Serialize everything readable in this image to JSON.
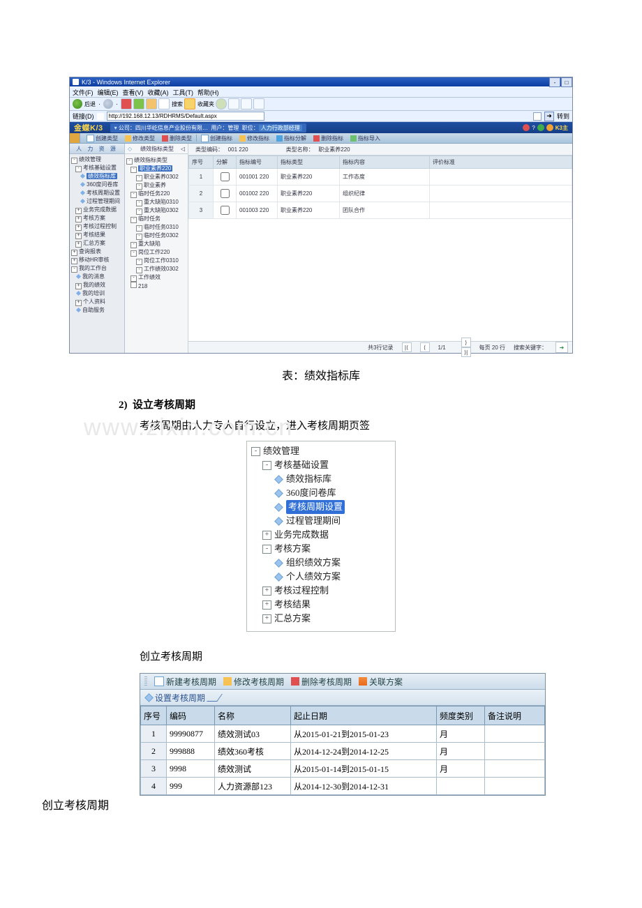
{
  "ie": {
    "title": "K/3 - Windows Internet Explorer",
    "menus": [
      "文件(F)",
      "编辑(E)",
      "查看(V)",
      "收藏(A)",
      "工具(T)",
      "帮助(H)"
    ],
    "toolbar": {
      "back": "后退",
      "search": "搜索",
      "fav": "收藏夹"
    },
    "address_label": "链接(D)",
    "address": "http://192.168.12.13/RDHRMS/Default.aspx",
    "go": "转到"
  },
  "k3": {
    "logo": "金蝶K/3",
    "company": "公司：四川华屹信息产业股份有限…",
    "user": "用户：管理",
    "post_label": "职位：",
    "post": "人力行政部经理",
    "right": "K3主",
    "toolbar": {
      "newtype": "创建类型",
      "edittype": "修改类型",
      "deltype": "删除类型",
      "newind": "创建指标",
      "editind": "修改指标",
      "cat": "指标分解",
      "delind": "删除指标",
      "import": "指标导入"
    },
    "navtitle": "人 力 资 源",
    "nav": {
      "root": "绩效管理",
      "base": "考核基础设置",
      "lib": "绩效指标库",
      "q360": "360度问卷库",
      "cycle": "考核周期设置",
      "period": "过程管理期间",
      "biz": "业务完成数据",
      "plan": "考核方案",
      "proc": "考核过程控制",
      "result": "考核结果",
      "sum": "汇总方案",
      "query": "查询报表",
      "mobile": "移动HR审核",
      "mywork": "我的工作台",
      "mymsg": "我的消息",
      "myperf": "我的绩效",
      "mytrain": "我的培训",
      "myinfo": "个人资料",
      "selfserv": "自助服务"
    },
    "midhead": "绩效指标类型",
    "midhead_icon": "◁",
    "mid": [
      "绩效指标类型",
      "职业素养220",
      "职业素养0302",
      "职业素养",
      "临时任务220",
      "重大缺陷0310",
      "重大缺陷0302",
      "临时任务",
      "临时任务0310",
      "临时任务0302",
      "重大缺陷",
      "岗位工作220",
      "岗位工作0310",
      "工作绩效0302",
      "工作绩效",
      "218"
    ],
    "midsel": "职业素养220",
    "info": {
      "codelabel": "类型编码：",
      "code": "001 220",
      "namelabel": "类型名称：",
      "name": "职业素养220"
    },
    "cols": [
      "序号",
      "分解",
      "指标编号",
      "指标类型",
      "指标内容",
      "评价标准"
    ],
    "rows": [
      {
        "no": "1",
        "code": "001001 220",
        "type": "职业素养220",
        "content": "工作态度"
      },
      {
        "no": "2",
        "code": "001002 220",
        "type": "职业素养220",
        "content": "组织纪律"
      },
      {
        "no": "3",
        "code": "001003 220",
        "type": "职业素养220",
        "content": "团队合作"
      }
    ],
    "pager": {
      "total": "共3行记录",
      "page": "1/1",
      "perpage": "每页 20 行",
      "searchlabel": "搜索关键字："
    }
  },
  "doc": {
    "caption": "表：绩效指标库",
    "step_no": "2)",
    "step_title": "设立考核周期",
    "para": "考核周期由人力专人自行设立，进入考核周期页签",
    "watermark": "www.zixin.com.cn",
    "subhead": "创立考核周期",
    "callout": "创立考核周期"
  },
  "nav2": {
    "root": "绩效管理",
    "items": [
      {
        "box": "-",
        "indent": 0,
        "label": "绩效管理"
      },
      {
        "box": "-",
        "indent": 1,
        "label": "考核基础设置"
      },
      {
        "dm": true,
        "indent": 2,
        "label": "绩效指标库"
      },
      {
        "dm": true,
        "indent": 2,
        "label": "360度问卷库"
      },
      {
        "dm": true,
        "indent": 2,
        "label": "考核周期设置",
        "selected": true
      },
      {
        "dm": true,
        "indent": 2,
        "label": "过程管理期间"
      },
      {
        "box": "+",
        "indent": 1,
        "label": "业务完成数据"
      },
      {
        "box": "-",
        "indent": 1,
        "label": "考核方案"
      },
      {
        "dm": true,
        "indent": 2,
        "label": "组织绩效方案"
      },
      {
        "dm": true,
        "indent": 2,
        "label": "个人绩效方案"
      },
      {
        "box": "+",
        "indent": 1,
        "label": "考核过程控制"
      },
      {
        "box": "+",
        "indent": 1,
        "label": "考核结果"
      },
      {
        "box": "+",
        "indent": 1,
        "label": "汇总方案"
      }
    ]
  },
  "cyc": {
    "toolbar": {
      "new": "新建考核周期",
      "edit": "修改考核周期",
      "del": "删除考核周期",
      "link": "关联方案"
    },
    "section": "设置考核周期",
    "cols": [
      "序号",
      "编码",
      "名称",
      "起止日期",
      "频度类别",
      "备注说明"
    ],
    "rows": [
      {
        "no": "1",
        "code": "99990877",
        "name": "绩效测试03",
        "range": "从2015-01-21到2015-01-23",
        "freq": "月",
        "note": ""
      },
      {
        "no": "2",
        "code": "999888",
        "name": "绩效360考核",
        "range": "从2014-12-24到2014-12-25",
        "freq": "月",
        "note": ""
      },
      {
        "no": "3",
        "code": "9998",
        "name": "绩效测试",
        "range": "从2015-01-14到2015-01-15",
        "freq": "月",
        "note": ""
      },
      {
        "no": "4",
        "code": "999",
        "name": "人力资源部123",
        "range": "从2014-12-30到2014-12-31",
        "freq": "",
        "note": ""
      }
    ]
  }
}
